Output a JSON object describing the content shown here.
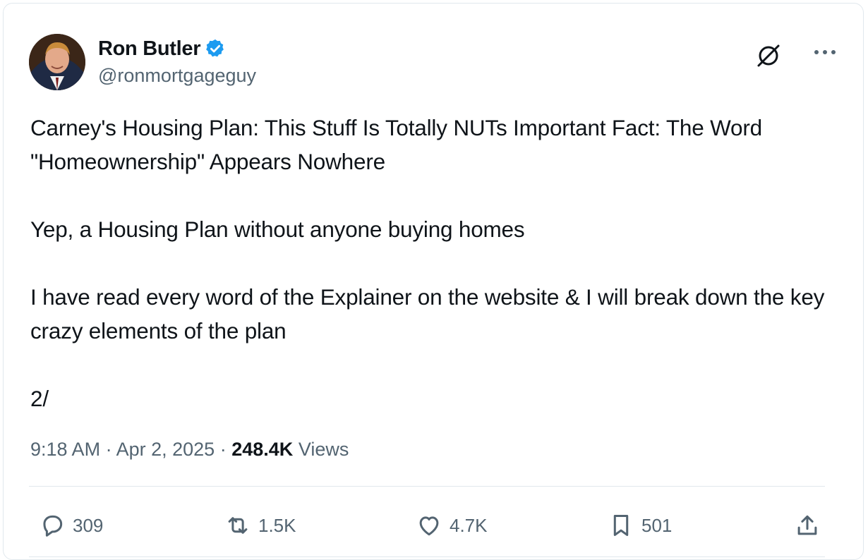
{
  "author": {
    "display_name": "Ron Butler",
    "handle": "@ronmortgageguy",
    "verified": true
  },
  "post": {
    "text": "Carney's Housing Plan: This Stuff Is Totally NUTs Important Fact: The Word \"Homeownership\" Appears Nowhere\n\nYep, a Housing Plan without anyone buying homes\n\nI have read every word of the Explainer on the website & I will break down the key crazy elements of the plan\n\n2/",
    "time": "9:18 AM",
    "separator": "·",
    "date": "Apr 2, 2025",
    "views_count": "248.4K",
    "views_label": "Views"
  },
  "actions": {
    "replies": "309",
    "reposts": "1.5K",
    "likes": "4.7K",
    "bookmarks": "501"
  },
  "icons": {
    "verified": "verified-badge-icon",
    "grok": "grok-icon",
    "more": "more-icon",
    "reply": "reply-icon",
    "repost": "repost-icon",
    "like": "heart-icon",
    "bookmark": "bookmark-icon",
    "share": "share-icon"
  },
  "colors": {
    "text_primary": "#0f1419",
    "text_secondary": "#536471",
    "verified_blue": "#1d9bf0",
    "divider": "#e1e8ed"
  }
}
